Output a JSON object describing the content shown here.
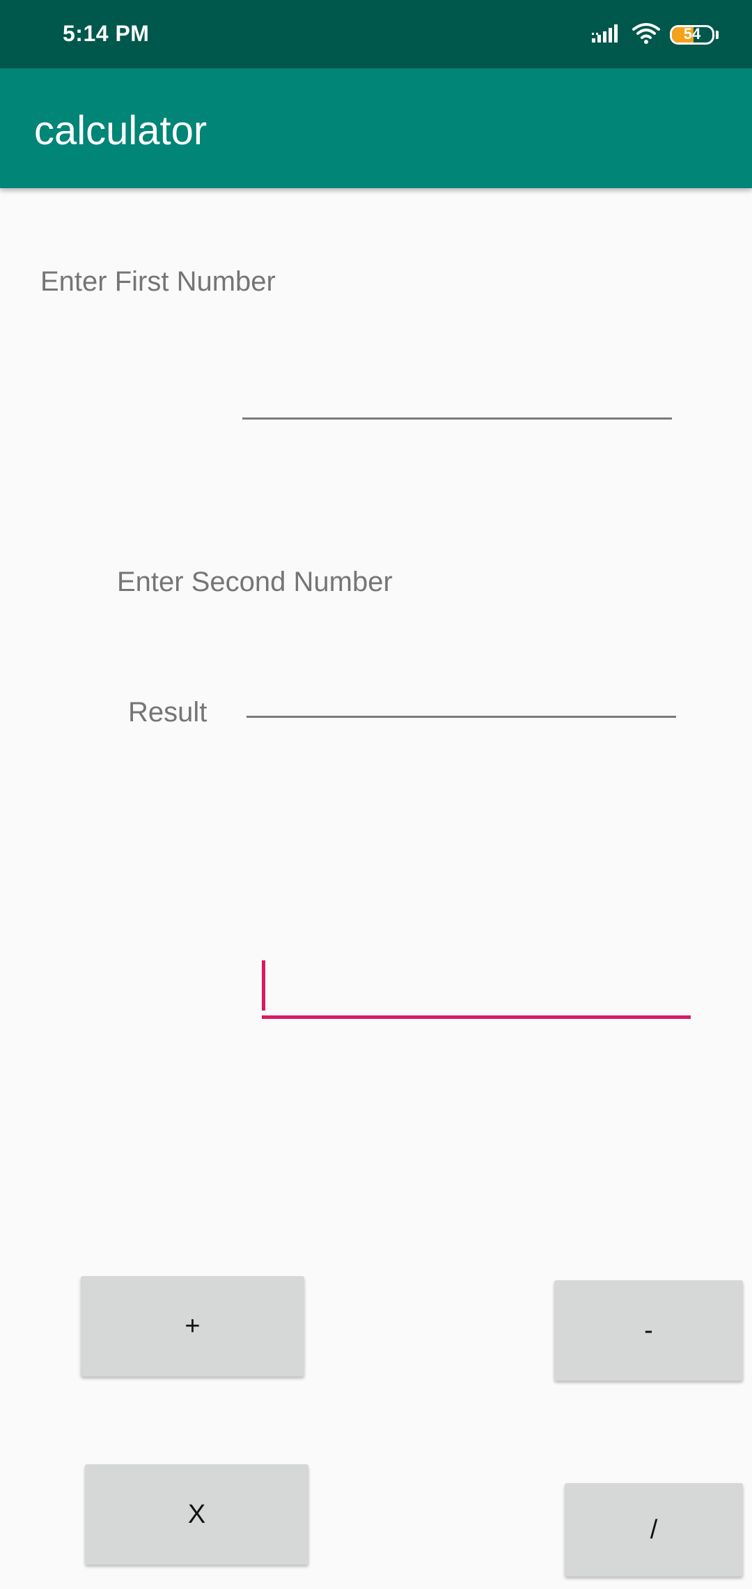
{
  "status_bar": {
    "time": "5:14 PM",
    "battery_level": "54",
    "battery_fraction": 0.54,
    "icons": [
      "signal-icon",
      "wifi-icon",
      "battery-icon"
    ]
  },
  "app_bar": {
    "title": "calculator",
    "color": "#008577",
    "status_color": "#00574b"
  },
  "form": {
    "first_number": {
      "label": "Enter First Number",
      "value": ""
    },
    "second_number": {
      "label": "Enter Second Number",
      "value": ""
    },
    "result": {
      "label": "Result",
      "value": ""
    },
    "focused_field_value": "",
    "accent_color": "#d81b60"
  },
  "buttons": {
    "add": "+",
    "subtract": "-",
    "multiply": "X",
    "divide": "/"
  }
}
